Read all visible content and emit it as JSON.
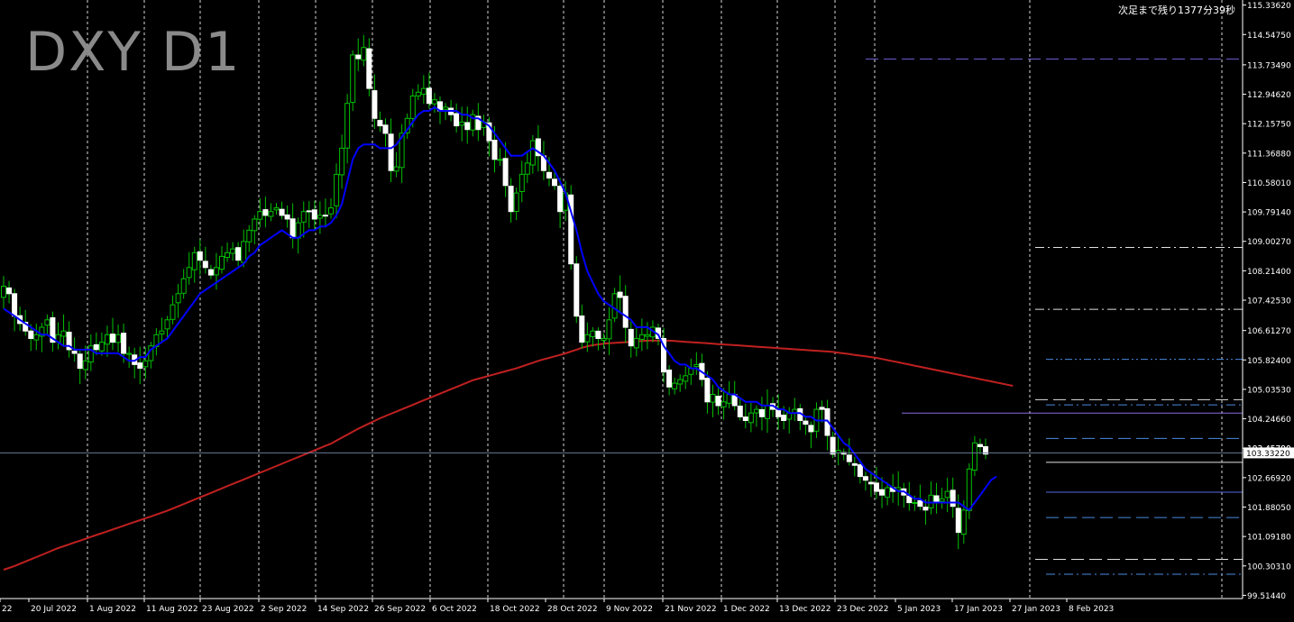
{
  "colors": {
    "background": "#000000",
    "grid": "#ffffff",
    "candle_up_body": "#000000",
    "candle_up_outline": "#00c000",
    "candle_down_body": "#ffffff",
    "candle_wick": "#00c000",
    "ma_short": "#0000ff",
    "ma_long": "#c02020",
    "axis_text": "#ffffff",
    "bid_line": "#7080a0",
    "price_tag_bg": "#ffffff",
    "price_tag_fg": "#000000"
  },
  "chart_data": {
    "type": "candlestick",
    "title": "DXY D1",
    "timer": "次足まで残り1377分39秒",
    "current_price": 103.3322,
    "current_price_label": "103.33220",
    "prev_price_label": "103.45790",
    "ylim": [
      99.5,
      115.4
    ],
    "y_ticks": [
      "115.33620",
      "114.54750",
      "113.73490",
      "112.94620",
      "112.15750",
      "111.36880",
      "110.58010",
      "109.79140",
      "109.00270",
      "108.21400",
      "107.42530",
      "106.61270",
      "105.82400",
      "105.03530",
      "104.24660",
      "103.45790",
      "102.66920",
      "101.88050",
      "101.09180",
      "100.30310",
      "99.51440"
    ],
    "x_labels": [
      "22",
      "20 Jul 2022",
      "1 Aug 2022",
      "11 Aug 2022",
      "23 Aug 2022",
      "2 Sep 2022",
      "14 Sep 2022",
      "26 Sep 2022",
      "6 Oct 2022",
      "18 Oct 2022",
      "28 Oct 2022",
      "9 Nov 2022",
      "21 Nov 2022",
      "1 Dec 2022",
      "13 Dec 2022",
      "23 Dec 2022",
      "5 Jan 2023",
      "17 Jan 2023",
      "27 Jan 2023",
      "8 Feb 2023"
    ],
    "closes": [
      107.8,
      107.6,
      107.0,
      106.8,
      106.6,
      106.4,
      106.5,
      106.7,
      106.9,
      106.3,
      106.5,
      106.6,
      106.1,
      106.0,
      105.6,
      105.8,
      106.2,
      106.1,
      106.3,
      106.5,
      106.3,
      106.5,
      106.0,
      106.0,
      105.7,
      105.6,
      105.8,
      106.2,
      106.5,
      106.6,
      106.9,
      107.3,
      107.6,
      108.0,
      108.3,
      108.7,
      108.5,
      108.3,
      108.1,
      108.3,
      108.6,
      108.7,
      108.8,
      108.5,
      109.0,
      109.3,
      109.6,
      109.8,
      109.7,
      109.8,
      109.9,
      109.7,
      109.6,
      109.1,
      109.5,
      109.8,
      109.8,
      109.6,
      109.7,
      109.7,
      109.9,
      110.8,
      111.5,
      112.7,
      114.0,
      113.9,
      114.2,
      113.1,
      112.3,
      112.1,
      111.9,
      110.9,
      111.0,
      111.9,
      112.3,
      112.9,
      113.0,
      113.1,
      112.7,
      112.8,
      112.5,
      112.6,
      112.4,
      112.1,
      112.2,
      112.0,
      112.4,
      112.0,
      112.2,
      111.7,
      111.2,
      111.2,
      110.5,
      109.8,
      110.3,
      110.8,
      111.1,
      111.7,
      111.3,
      110.9,
      110.7,
      110.5,
      109.8,
      110.3,
      108.4,
      107.0,
      106.3,
      106.5,
      106.6,
      106.4,
      106.4,
      106.9,
      107.6,
      107.5,
      106.7,
      106.2,
      106.4,
      106.5,
      106.5,
      106.7,
      106.4,
      105.5,
      105.1,
      105.2,
      105.3,
      105.4,
      105.6,
      105.7,
      105.3,
      104.7,
      104.9,
      104.6,
      104.7,
      104.9,
      104.6,
      104.3,
      104.2,
      104.4,
      104.5,
      104.3,
      104.6,
      104.5,
      104.3,
      104.2,
      104.4,
      104.5,
      104.2,
      104.1,
      103.9,
      104.5,
      104.5,
      103.8,
      103.3,
      103.4,
      103.3,
      103.1,
      103.0,
      102.7,
      102.6,
      102.5,
      102.3,
      102.2,
      102.4,
      102.3,
      102.4,
      102.2,
      102.0,
      102.0,
      101.9,
      101.8,
      102.2,
      102.0,
      102.1,
      102.3,
      101.9,
      101.2,
      101.8,
      102.9,
      103.6,
      103.5,
      103.3
    ],
    "ma_short": [
      107.2,
      107.1,
      107.0,
      106.9,
      106.8,
      106.7,
      106.6,
      106.5,
      106.5,
      106.4,
      106.3,
      106.2,
      106.2,
      106.1,
      106.1,
      106.1,
      106.1,
      106.0,
      106.0,
      106.0,
      106.0,
      106.0,
      105.9,
      105.8,
      105.8,
      105.9,
      105.9,
      106.1,
      106.2,
      106.3,
      106.4,
      106.6,
      106.8,
      107.0,
      107.2,
      107.4,
      107.6,
      107.7,
      107.8,
      107.9,
      108.0,
      108.1,
      108.2,
      108.3,
      108.4,
      108.6,
      108.7,
      108.9,
      109.0,
      109.1,
      109.2,
      109.3,
      109.2,
      109.1,
      109.1,
      109.2,
      109.3,
      109.3,
      109.4,
      109.4,
      109.5,
      109.7,
      110.0,
      110.6,
      111.2,
      111.5,
      111.6,
      111.6,
      111.6,
      111.5,
      111.5,
      111.5,
      111.6,
      111.8,
      112.0,
      112.2,
      112.4,
      112.5,
      112.5,
      112.6,
      112.5,
      112.5,
      112.5,
      112.5,
      112.4,
      112.4,
      112.3,
      112.3,
      112.2,
      112.1,
      111.9,
      111.7,
      111.5,
      111.3,
      111.3,
      111.3,
      111.4,
      111.5,
      111.4,
      111.3,
      111.1,
      110.9,
      110.6,
      110.3,
      109.8,
      109.3,
      108.7,
      108.2,
      107.9,
      107.6,
      107.4,
      107.3,
      107.2,
      107.1,
      107.0,
      106.9,
      106.7,
      106.7,
      106.7,
      106.6,
      106.5,
      106.2,
      106.0,
      105.8,
      105.7,
      105.7,
      105.6,
      105.6,
      105.5,
      105.4,
      105.3,
      105.1,
      105.0,
      104.9,
      104.9,
      104.8,
      104.7,
      104.7,
      104.7,
      104.6,
      104.6,
      104.6,
      104.5,
      104.5,
      104.4,
      104.4,
      104.4,
      104.3,
      104.3,
      104.2,
      104.2,
      104.2,
      104.0,
      103.8,
      103.6,
      103.5,
      103.3,
      103.1,
      102.9,
      102.8,
      102.7,
      102.6,
      102.5,
      102.4,
      102.3,
      102.3,
      102.2,
      102.1,
      102.1,
      102.0,
      102.0,
      102.0,
      102.0,
      102.0,
      102.0,
      102.0,
      101.9,
      101.8,
      102.0,
      102.2,
      102.4,
      102.6,
      102.7
    ],
    "ma_long": [
      100.2,
      100.25,
      100.3,
      100.36,
      100.42,
      100.48,
      100.54,
      100.6,
      100.66,
      100.72,
      100.78,
      100.83,
      100.88,
      100.93,
      100.98,
      101.03,
      101.08,
      101.13,
      101.18,
      101.23,
      101.28,
      101.33,
      101.38,
      101.43,
      101.48,
      101.53,
      101.58,
      101.63,
      101.68,
      101.73,
      101.78,
      101.84,
      101.9,
      101.96,
      102.02,
      102.08,
      102.14,
      102.2,
      102.26,
      102.32,
      102.38,
      102.44,
      102.5,
      102.56,
      102.62,
      102.68,
      102.74,
      102.8,
      102.86,
      102.92,
      102.98,
      103.04,
      103.1,
      103.16,
      103.22,
      103.28,
      103.34,
      103.4,
      103.46,
      103.52,
      103.58,
      103.66,
      103.74,
      103.82,
      103.9,
      103.98,
      104.05,
      104.12,
      104.19,
      104.26,
      104.32,
      104.38,
      104.44,
      104.5,
      104.56,
      104.62,
      104.68,
      104.74,
      104.8,
      104.86,
      104.92,
      104.98,
      105.04,
      105.1,
      105.16,
      105.22,
      105.28,
      105.32,
      105.36,
      105.4,
      105.44,
      105.48,
      105.52,
      105.56,
      105.6,
      105.65,
      105.7,
      105.75,
      105.8,
      105.84,
      105.88,
      105.92,
      105.96,
      106.0,
      106.05,
      106.1,
      106.15,
      106.19,
      106.22,
      106.24,
      106.26,
      106.27,
      106.28,
      106.29,
      106.3,
      106.31,
      106.32,
      106.33,
      106.34,
      106.34,
      106.34,
      106.34,
      106.34,
      106.33,
      106.32,
      106.31,
      106.3,
      106.29,
      106.28,
      106.27,
      106.26,
      106.25,
      106.24,
      106.23,
      106.22,
      106.21,
      106.2,
      106.19,
      106.18,
      106.17,
      106.16,
      106.15,
      106.14,
      106.13,
      106.12,
      106.11,
      106.1,
      106.09,
      106.08,
      106.07,
      106.06,
      106.05,
      106.04,
      106.02,
      106.0,
      105.98,
      105.96,
      105.94,
      105.92,
      105.9,
      105.88,
      105.85,
      105.82,
      105.79,
      105.76,
      105.73,
      105.7,
      105.67,
      105.64,
      105.61,
      105.58,
      105.55,
      105.52,
      105.49,
      105.46,
      105.43,
      105.4,
      105.37,
      105.34,
      105.31,
      105.28,
      105.25,
      105.22,
      105.19,
      105.16,
      105.13
    ],
    "ma_long_start_index": 0,
    "ma_long_end_index": 174,
    "horizontal_levels": [
      {
        "price": 113.89,
        "style": "longdash",
        "color": "#6a5acd",
        "from_x": 960
      },
      {
        "price": 108.84,
        "style": "dashdot",
        "color": "#e0e0e0",
        "from_x": 1148
      },
      {
        "price": 107.18,
        "style": "dashdot",
        "color": "#e0e0e0",
        "from_x": 1148
      },
      {
        "price": 105.84,
        "style": "dashdotdot",
        "color": "#4a8ae0",
        "from_x": 1160
      },
      {
        "price": 104.76,
        "style": "longdash",
        "color": "#e0e0e0",
        "from_x": 1148
      },
      {
        "price": 104.62,
        "style": "dashdot",
        "color": "#4a8ae0",
        "from_x": 1160
      },
      {
        "price": 104.4,
        "style": "solid",
        "color": "#8a6ae0",
        "from_x": 1000
      },
      {
        "price": 103.72,
        "style": "longdash",
        "color": "#4a8ae0",
        "from_x": 1160
      },
      {
        "price": 103.08,
        "style": "solid",
        "color": "#e0e0e0",
        "from_x": 1160
      },
      {
        "price": 102.28,
        "style": "solid",
        "color": "#5a6ae0",
        "from_x": 1160
      },
      {
        "price": 101.6,
        "style": "longdash",
        "color": "#4a8ae0",
        "from_x": 1160
      },
      {
        "price": 100.48,
        "style": "longdash",
        "color": "#e0e0e0",
        "from_x": 1148
      },
      {
        "price": 100.08,
        "style": "dashdot",
        "color": "#4a8ae0",
        "from_x": 1160
      }
    ]
  }
}
